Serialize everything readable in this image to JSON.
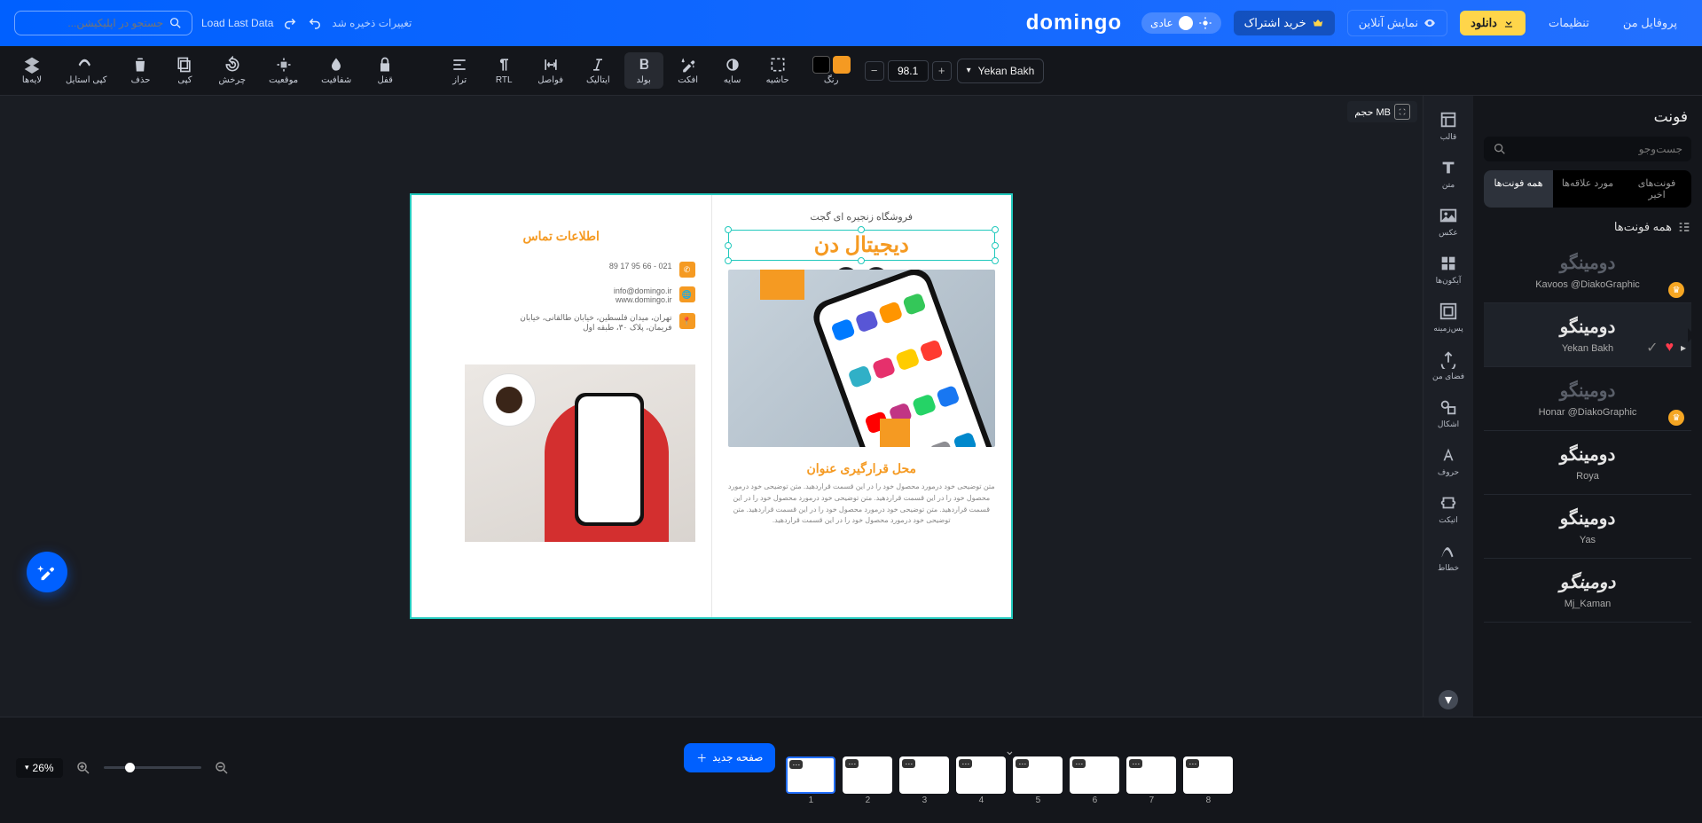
{
  "header": {
    "profile": "پروفایل من",
    "settings": "تنظیمات",
    "download": "دانلود",
    "preview": "نمایش آنلاین",
    "buy": "خرید اشتراک",
    "mode": "عادی",
    "logo": "domingo",
    "saved": "تغییرات ذخیره شد",
    "load": "Load Last Data",
    "search_ph": "جستجو در اپلیکیشن..."
  },
  "toolbar": {
    "layers": "لایه‌ها",
    "copystyle": "کپی استایل",
    "delete": "حذف",
    "copy": "کپی",
    "rotate": "چرخش",
    "position": "موقعیت",
    "opacity": "شفافیت",
    "lock": "قفل",
    "align": "تراز",
    "rtl": "RTL",
    "spacing": "فواصل",
    "italic": "ایتالیک",
    "bold": "بولد",
    "effect": "افکت",
    "shadow": "سایه",
    "border": "حاشیه",
    "color": "رنگ",
    "size": "98.1",
    "font": "Yekan Bakh"
  },
  "canvas": {
    "badge": "حجم MB",
    "subtitle": "فروشگاه زنجیره ای گجت",
    "title_sel": "دیجیتال دن",
    "heading": "محل قرارگیری عنوان",
    "body": "متن توضیحی خود درمورد محصول خود را در این قسمت قراردهید. متن توضیحی خود درمورد محصول خود را در این قسمت قراردهید. متن توضیحی خود درمورد محصول خود را در این قسمت قراردهید. متن توضیحی خود درمورد محصول خود را در این قسمت قراردهید. متن توضیحی خود درمورد محصول خود را در این قسمت قراردهید.",
    "contact_title": "اطلاعات تماس",
    "phone": "021 - 66 95 17 89",
    "email": "info@domingo.ir",
    "web": "www.domingo.ir",
    "address": "تهران، میدان فلسطین، خیابان طالقانی، خیابان فریمان، پلاک ۳۰، طبقه اول"
  },
  "panel": {
    "title": "فونت",
    "search_ph": "جست‌وجو",
    "tab_all": "همه فونت‌ها",
    "tab_fav": "مورد علاقه‌ها",
    "tab_recent": "فونت‌های اخیر",
    "list_head": "همه فونت‌ها",
    "sample": "دومینگو",
    "f1": "Kavoos @DiakoGraphic",
    "f2": "Yekan Bakh",
    "f3": "Honar @DiakoGraphic",
    "f4": "Roya",
    "f5": "Yas",
    "f6": "Mj_Kaman"
  },
  "nav": {
    "template": "قالب",
    "text": "متن",
    "image": "عکس",
    "icons": "آیکون‌ها",
    "bg": "پس‌زمینه",
    "myspace": "فضای من",
    "shapes": "اشکال",
    "letters": "حروف",
    "ticket": "اتیکت",
    "line": "خطاط"
  },
  "bottom": {
    "zoom": "26%",
    "newpage": "صفحه جدید",
    "thumbs": [
      "1",
      "2",
      "3",
      "4",
      "5",
      "6",
      "7",
      "8"
    ]
  }
}
